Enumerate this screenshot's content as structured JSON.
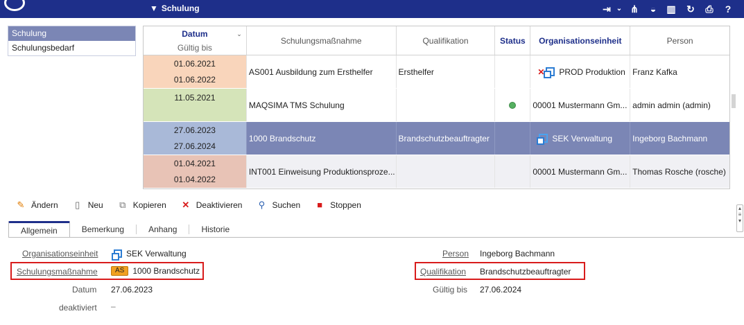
{
  "header": {
    "title": "Schulung",
    "filter_icon": "filter-icon",
    "icons": [
      "login-icon",
      "sitemap-icon",
      "dashboard-icon",
      "barcode-icon",
      "refresh-icon",
      "print-icon",
      "help-icon"
    ]
  },
  "nav": {
    "items": [
      "Schulung",
      "Schulungsbedarf"
    ]
  },
  "grid": {
    "headers": {
      "datum": "Datum",
      "gueltig_bis": "Gültig bis",
      "massnahme": "Schulungsmaßnahme",
      "qualifikation": "Qualifikation",
      "status": "Status",
      "org": "Organisationseinheit",
      "person": "Person"
    },
    "rows": [
      {
        "d1": "01.06.2021",
        "d2": "01.06.2022",
        "massnahme": "AS001 Ausbildung zum Ersthelfer",
        "qualifikation": "Ersthelfer",
        "status": "",
        "org": "PROD Produktion",
        "person": "Franz Kafka",
        "date_color": "#f9d5bb"
      },
      {
        "d1": "11.05.2021",
        "d2": "",
        "massnahme": "MAQSIMA TMS Schulung",
        "qualifikation": "",
        "status": "ok",
        "org": "00001 Mustermann Gm...",
        "person": "admin admin (admin)",
        "date_color": "#d5e4b9"
      },
      {
        "d1": "27.06.2023",
        "d2": "27.06.2024",
        "massnahme": "1000 Brandschutz",
        "qualifikation": "Brandschutzbeauftragter",
        "status": "",
        "org": "SEK Verwaltung",
        "person": "Ingeborg Bachmann",
        "date_color": "#a9b9d8"
      },
      {
        "d1": "01.04.2021",
        "d2": "01.04.2022",
        "massnahme": "INT001 Einweisung Produktionsproze...",
        "qualifikation": "",
        "status": "",
        "org": "00001 Mustermann Gm...",
        "person": "Thomas Rosche (rosche)",
        "date_color": "#e8c3b6"
      }
    ]
  },
  "toolbar": {
    "edit": "Ändern",
    "new": "Neu",
    "copy": "Kopieren",
    "deactivate": "Deaktivieren",
    "search": "Suchen",
    "stop": "Stoppen"
  },
  "tabs": [
    "Allgemein",
    "Bemerkung",
    "Anhang",
    "Historie"
  ],
  "detail": {
    "org_label": "Organisationseinheit",
    "org_value": "SEK Verwaltung",
    "massnahme_label": "Schulungsmaßnahme",
    "massnahme_badge": "AS",
    "massnahme_value": "1000 Brandschutz",
    "datum_label": "Datum",
    "datum_value": "27.06.2023",
    "deaktiviert_label": "deaktiviert",
    "deaktiviert_value": "–",
    "person_label": "Person",
    "person_value": "Ingeborg Bachmann",
    "qualifikation_label": "Qualifikation",
    "qualifikation_value": "Brandschutzbeauftragter",
    "gueltig_label": "Gültig bis",
    "gueltig_value": "27.06.2024"
  },
  "colors": {
    "header_bg": "#1e2f8a",
    "selected_row": "#7b86b5",
    "highlight_box": "#d81b1b",
    "badge": "#f0a020"
  }
}
